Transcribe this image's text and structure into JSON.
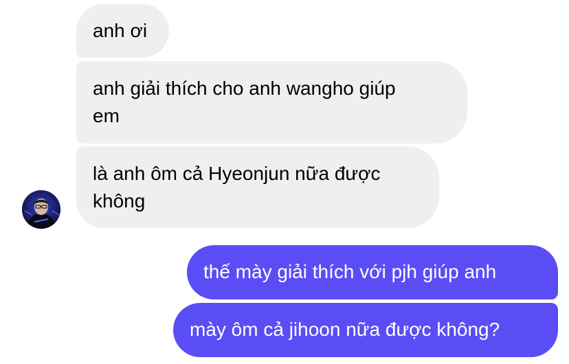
{
  "conversation": {
    "messages": [
      {
        "sender": "other",
        "text": "anh ơi"
      },
      {
        "sender": "other",
        "text": "anh giải thích cho anh wangho giúp\nem"
      },
      {
        "sender": "other",
        "text": "là anh ôm cả Hyeonjun nữa được\nkhông"
      },
      {
        "sender": "me",
        "text": "thế mày giải thích với pjh giúp anh"
      },
      {
        "sender": "me",
        "text": "mày ôm cả jihoon nữa được không?"
      }
    ]
  },
  "contact": {
    "avatar_icon": "contact-avatar"
  },
  "colors": {
    "incoming_bubble": "#efefef",
    "outgoing_bubble": "#5b4df5",
    "outgoing_text": "#ffffff"
  }
}
